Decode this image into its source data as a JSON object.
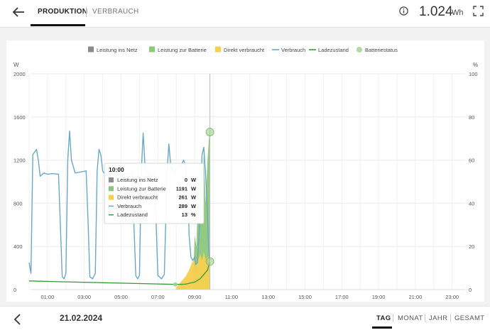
{
  "header": {
    "tabs": [
      {
        "label": "PRODUKTION",
        "active": true
      },
      {
        "label": "VERBRAUCH",
        "active": false
      }
    ],
    "total_value": "1.024",
    "total_unit": "Wh",
    "icons": {
      "back": "arrow-left-icon",
      "info": "info-icon",
      "fullscreen": "fullscreen-icon"
    }
  },
  "chart_data": {
    "type": "area",
    "x_ticks": [
      "01:00",
      "03:00",
      "05:00",
      "07:00",
      "09:00",
      "11:00",
      "13:00",
      "15:00",
      "17:00",
      "19:00",
      "21:00",
      "23:00"
    ],
    "y_left": {
      "unit": "W",
      "ticks": [
        "0",
        "400",
        "800",
        "1200",
        "1600",
        "2000"
      ],
      "range": [
        0,
        2000
      ]
    },
    "y_right": {
      "unit": "%",
      "ticks": [
        "0",
        "20",
        "40",
        "60",
        "80",
        "100"
      ],
      "range": [
        0,
        100
      ]
    },
    "legend": [
      {
        "name": "Leistung ins Netz",
        "color": "#8c8c8c",
        "shape": "square"
      },
      {
        "name": "Leistung zur Batterie",
        "color": "#8dc77b",
        "shape": "square"
      },
      {
        "name": "Direkt verbraucht",
        "color": "#f6cf4d",
        "shape": "square"
      },
      {
        "name": "Verbrauch",
        "color": "#6aa8c8",
        "shape": "line"
      },
      {
        "name": "Ladezustand",
        "color": "#3a9a3a",
        "shape": "line"
      },
      {
        "name": "Batteriestatus",
        "color": "#9dd08f",
        "shape": "circle"
      }
    ],
    "series": [
      {
        "name": "Verbrauch",
        "axis": "left",
        "points": [
          [
            0.0,
            250
          ],
          [
            0.1,
            150
          ],
          [
            0.2,
            1250
          ],
          [
            0.4,
            1300
          ],
          [
            0.5,
            1200
          ],
          [
            0.6,
            1050
          ],
          [
            0.8,
            1080
          ],
          [
            1.0,
            1070
          ],
          [
            1.3,
            1075
          ],
          [
            1.6,
            1070
          ],
          [
            1.7,
            600
          ],
          [
            1.8,
            120
          ],
          [
            1.9,
            100
          ],
          [
            2.0,
            150
          ],
          [
            2.1,
            1200
          ],
          [
            2.2,
            1470
          ],
          [
            2.3,
            1200
          ],
          [
            2.5,
            1080
          ],
          [
            2.8,
            1090
          ],
          [
            3.1,
            1100
          ],
          [
            3.2,
            650
          ],
          [
            3.3,
            120
          ],
          [
            3.45,
            100
          ],
          [
            3.6,
            150
          ],
          [
            3.7,
            1100
          ],
          [
            3.8,
            1300
          ],
          [
            3.9,
            1250
          ],
          [
            4.0,
            1100
          ],
          [
            4.2,
            1050
          ],
          [
            4.5,
            1070
          ],
          [
            4.6,
            1120
          ],
          [
            4.7,
            1000
          ],
          [
            4.8,
            1050
          ],
          [
            5.0,
            1150
          ],
          [
            5.1,
            1100
          ],
          [
            5.3,
            1070
          ],
          [
            5.6,
            1080
          ],
          [
            5.7,
            600
          ],
          [
            5.8,
            130
          ],
          [
            5.9,
            100
          ],
          [
            6.0,
            130
          ],
          [
            6.1,
            1100
          ],
          [
            6.2,
            1450
          ],
          [
            6.3,
            1150
          ],
          [
            6.5,
            1060
          ],
          [
            6.8,
            1070
          ],
          [
            6.9,
            650
          ],
          [
            7.0,
            130
          ],
          [
            7.2,
            100
          ],
          [
            7.35,
            140
          ],
          [
            7.5,
            1100
          ],
          [
            7.6,
            1350
          ],
          [
            7.7,
            1150
          ],
          [
            7.9,
            1090
          ],
          [
            8.1,
            1150
          ],
          [
            8.2,
            1130
          ],
          [
            8.4,
            1200
          ],
          [
            8.5,
            1150
          ],
          [
            8.65,
            850
          ],
          [
            8.7,
            500
          ],
          [
            8.8,
            300
          ],
          [
            8.9,
            270
          ],
          [
            9.0,
            300
          ],
          [
            9.05,
            230
          ],
          [
            9.15,
            250
          ],
          [
            9.3,
            700
          ],
          [
            9.4,
            1250
          ],
          [
            9.5,
            1320
          ],
          [
            9.6,
            1060
          ],
          [
            9.7,
            700
          ],
          [
            9.75,
            400
          ],
          [
            9.8,
            289
          ],
          [
            9.83,
            300
          ]
        ]
      },
      {
        "name": "Direkt verbraucht",
        "axis": "left",
        "points": [
          [
            7.95,
            0
          ],
          [
            8.05,
            30
          ],
          [
            8.2,
            60
          ],
          [
            8.5,
            120
          ],
          [
            8.7,
            180
          ],
          [
            8.85,
            250
          ],
          [
            9.0,
            280
          ],
          [
            9.05,
            230
          ],
          [
            9.15,
            250
          ],
          [
            9.3,
            330
          ],
          [
            9.4,
            270
          ],
          [
            9.5,
            350
          ],
          [
            9.6,
            280
          ],
          [
            9.7,
            300
          ],
          [
            9.75,
            310
          ],
          [
            9.8,
            261
          ],
          [
            9.83,
            261
          ],
          [
            9.83,
            0
          ]
        ]
      },
      {
        "name": "Leistung zur Batterie",
        "axis": "left",
        "points": [
          [
            8.9,
            0
          ],
          [
            9.0,
            500
          ],
          [
            9.1,
            400
          ],
          [
            9.2,
            1100
          ],
          [
            9.3,
            750
          ],
          [
            9.4,
            600
          ],
          [
            9.5,
            1300
          ],
          [
            9.6,
            800
          ],
          [
            9.7,
            1200
          ],
          [
            9.8,
            1450
          ],
          [
            9.83,
            1452
          ],
          [
            9.83,
            0
          ]
        ]
      },
      {
        "name": "Ladezustand",
        "axis": "right",
        "points": [
          [
            0.0,
            4
          ],
          [
            2.0,
            3.6
          ],
          [
            4.0,
            3.2
          ],
          [
            6.0,
            2.8
          ],
          [
            7.95,
            2.4
          ],
          [
            8.5,
            2.5
          ],
          [
            9.0,
            3.5
          ],
          [
            9.3,
            5
          ],
          [
            9.5,
            7
          ],
          [
            9.7,
            9
          ],
          [
            9.83,
            13
          ]
        ]
      }
    ],
    "battery_status_points": [
      [
        7.95,
        2.4
      ],
      [
        9.83,
        73
      ],
      [
        9.83,
        13
      ]
    ],
    "cursor_hour": 9.83,
    "tooltip": {
      "time": "10:00",
      "rows": [
        {
          "name": "Leistung ins Netz",
          "value": "0",
          "unit": "W",
          "color": "#8c8c8c",
          "shape": "square"
        },
        {
          "name": "Leistung zur Batterie",
          "value": "1191",
          "unit": "W",
          "color": "#8dc77b",
          "shape": "square"
        },
        {
          "name": "Direkt verbraucht",
          "value": "261",
          "unit": "W",
          "color": "#f6cf4d",
          "shape": "square"
        },
        {
          "name": "Verbrauch",
          "value": "289",
          "unit": "W",
          "color": "#6aa8c8",
          "shape": "line"
        },
        {
          "name": "Ladezustand",
          "value": "13",
          "unit": "%",
          "color": "#3a9a3a",
          "shape": "line"
        }
      ]
    }
  },
  "footer": {
    "date": "21.02.2024",
    "periods": [
      "TAG",
      "MONAT",
      "JAHR",
      "GESAMT"
    ],
    "active_period": "TAG",
    "icons": {
      "prev": "chevron-left-icon"
    }
  }
}
